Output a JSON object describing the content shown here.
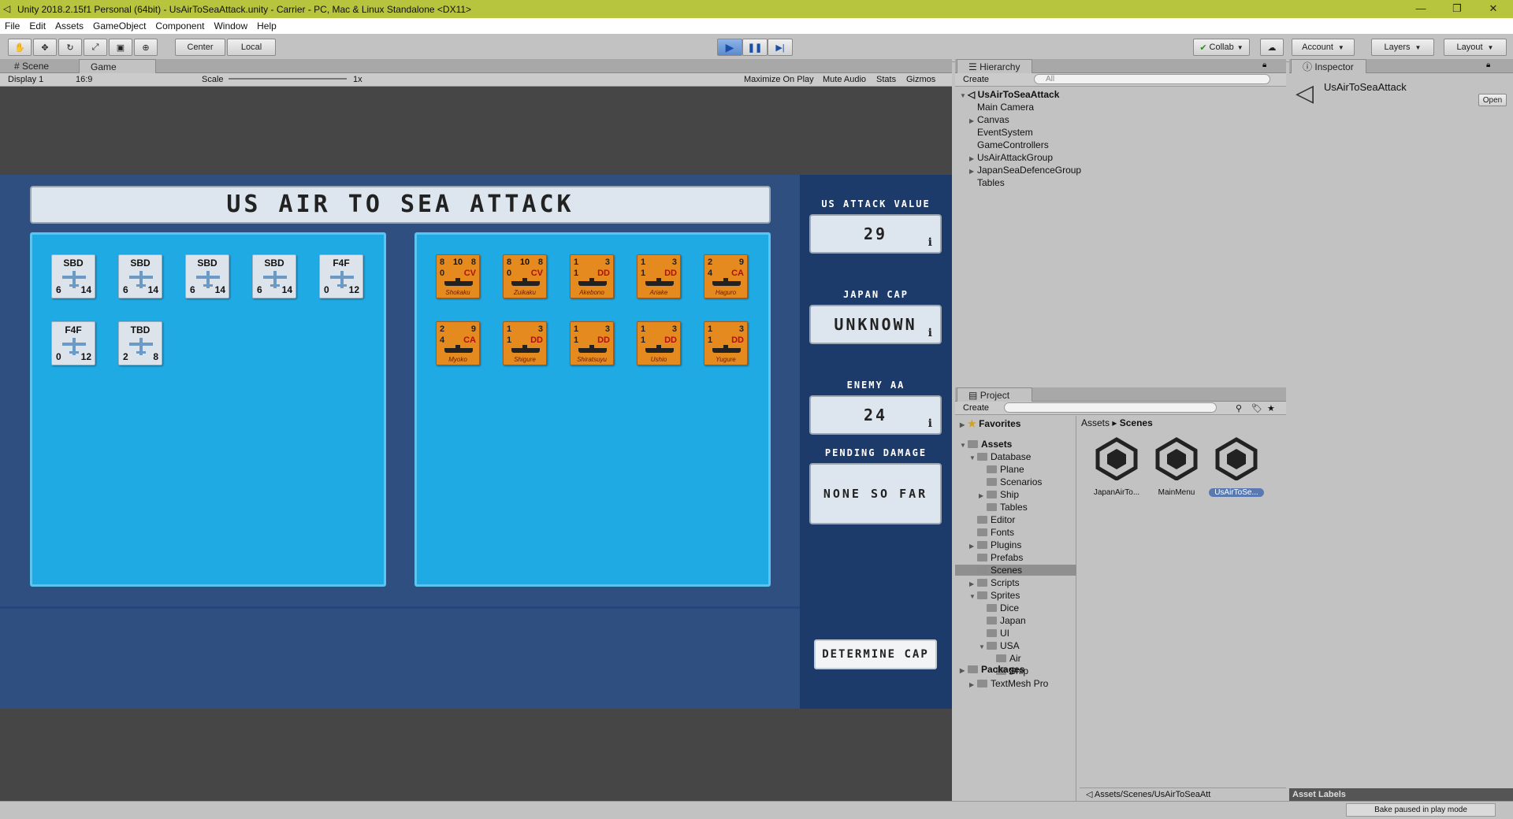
{
  "window": {
    "title": "Unity 2018.2.15f1 Personal (64bit) - UsAirToSeaAttack.unity - Carrier - PC, Mac & Linux Standalone <DX11>"
  },
  "menu": [
    "File",
    "Edit",
    "Assets",
    "GameObject",
    "Component",
    "Window",
    "Help"
  ],
  "toolbar": {
    "pivot": "Center",
    "space": "Local",
    "collab": "Collab",
    "account": "Account",
    "layers": "Layers",
    "layout": "Layout"
  },
  "tabs": {
    "scene": "Scene",
    "game": "Game",
    "hierarchy": "Hierarchy",
    "inspector": "Inspector",
    "project": "Project"
  },
  "gamebar": {
    "display": "Display 1",
    "aspect": "16:9",
    "scale_label": "Scale",
    "scale_value": "1x",
    "maximize": "Maximize On Play",
    "mute": "Mute Audio",
    "stats": "Stats",
    "gizmos": "Gizmos"
  },
  "game": {
    "title": "US AIR TO SEA ATTACK",
    "planes": [
      {
        "type": "SBD",
        "l": "6",
        "r": "14"
      },
      {
        "type": "SBD",
        "l": "6",
        "r": "14"
      },
      {
        "type": "SBD",
        "l": "6",
        "r": "14"
      },
      {
        "type": "SBD",
        "l": "6",
        "r": "14"
      },
      {
        "type": "F4F",
        "l": "0",
        "r": "12"
      },
      {
        "type": "F4F",
        "l": "0",
        "r": "12"
      },
      {
        "type": "TBD",
        "l": "2",
        "r": "8"
      }
    ],
    "ships": [
      {
        "tl": "8",
        "tm": "10",
        "tr": "8",
        "bl": "0",
        "br": "CV",
        "name": "Shokaku"
      },
      {
        "tl": "8",
        "tm": "10",
        "tr": "8",
        "bl": "0",
        "br": "CV",
        "name": "Zuikaku"
      },
      {
        "tl": "1",
        "tm": "",
        "tr": "3",
        "bl": "1",
        "br": "DD",
        "name": "Akebono"
      },
      {
        "tl": "1",
        "tm": "",
        "tr": "3",
        "bl": "1",
        "br": "DD",
        "name": "Ariake"
      },
      {
        "tl": "2",
        "tm": "",
        "tr": "9",
        "bl": "4",
        "br": "CA",
        "name": "Haguro"
      },
      {
        "tl": "2",
        "tm": "",
        "tr": "9",
        "bl": "4",
        "br": "CA",
        "name": "Myoko"
      },
      {
        "tl": "1",
        "tm": "",
        "tr": "3",
        "bl": "1",
        "br": "DD",
        "name": "Shigure"
      },
      {
        "tl": "1",
        "tm": "",
        "tr": "3",
        "bl": "1",
        "br": "DD",
        "name": "Shiratsuyu"
      },
      {
        "tl": "1",
        "tm": "",
        "tr": "3",
        "bl": "1",
        "br": "DD",
        "name": "Ushio"
      },
      {
        "tl": "1",
        "tm": "",
        "tr": "3",
        "bl": "1",
        "br": "DD",
        "name": "Yugure"
      }
    ],
    "side": {
      "attack_label": "US ATTACK VALUE",
      "attack_value": "29",
      "cap_label": "JAPAN CAP",
      "cap_value": "UNKNOWN",
      "aa_label": "ENEMY AA",
      "aa_value": "24",
      "damage_label": "PENDING DAMAGE",
      "damage_value": "NONE SO FAR",
      "info": "i",
      "button": "DETERMINE CAP"
    }
  },
  "hierarchy": {
    "create": "Create",
    "search_placeholder": "All",
    "root": "UsAirToSeaAttack",
    "items": [
      {
        "label": "Main Camera",
        "arrow": false
      },
      {
        "label": "Canvas",
        "arrow": true
      },
      {
        "label": "EventSystem",
        "arrow": false
      },
      {
        "label": "GameControllers",
        "arrow": false
      },
      {
        "label": "UsAirAttackGroup",
        "arrow": true
      },
      {
        "label": "JapanSeaDefenceGroup",
        "arrow": true
      },
      {
        "label": "Tables",
        "arrow": false
      }
    ]
  },
  "inspector": {
    "name": "UsAirToSeaAttack",
    "open": "Open",
    "asset_labels": "Asset Labels"
  },
  "project": {
    "create": "Create",
    "favorites": "Favorites",
    "assets": "Assets",
    "tree": [
      {
        "label": "Database",
        "depth": 1,
        "arrow": "open"
      },
      {
        "label": "Plane",
        "depth": 2,
        "arrow": ""
      },
      {
        "label": "Scenarios",
        "depth": 2,
        "arrow": ""
      },
      {
        "label": "Ship",
        "depth": 2,
        "arrow": "closed"
      },
      {
        "label": "Tables",
        "depth": 2,
        "arrow": ""
      },
      {
        "label": "Editor",
        "depth": 1,
        "arrow": ""
      },
      {
        "label": "Fonts",
        "depth": 1,
        "arrow": ""
      },
      {
        "label": "Plugins",
        "depth": 1,
        "arrow": "closed"
      },
      {
        "label": "Prefabs",
        "depth": 1,
        "arrow": ""
      },
      {
        "label": "Scenes",
        "depth": 1,
        "arrow": "",
        "selected": true
      },
      {
        "label": "Scripts",
        "depth": 1,
        "arrow": "closed"
      },
      {
        "label": "Sprites",
        "depth": 1,
        "arrow": "open"
      },
      {
        "label": "Dice",
        "depth": 2,
        "arrow": ""
      },
      {
        "label": "Japan",
        "depth": 2,
        "arrow": ""
      },
      {
        "label": "UI",
        "depth": 2,
        "arrow": ""
      },
      {
        "label": "USA",
        "depth": 2,
        "arrow": "open"
      },
      {
        "label": "Air",
        "depth": 3,
        "arrow": ""
      },
      {
        "label": "Ship",
        "depth": 3,
        "arrow": ""
      },
      {
        "label": "TextMesh Pro",
        "depth": 1,
        "arrow": "closed"
      }
    ],
    "packages": "Packages",
    "breadcrumb_root": "Assets",
    "breadcrumb_current": "Scenes",
    "files": [
      "JapanAirTo...",
      "MainMenu",
      "UsAirToSe..."
    ],
    "path": "Assets/Scenes/UsAirToSeaAtt"
  },
  "status": {
    "bake": "Bake paused in play mode"
  }
}
